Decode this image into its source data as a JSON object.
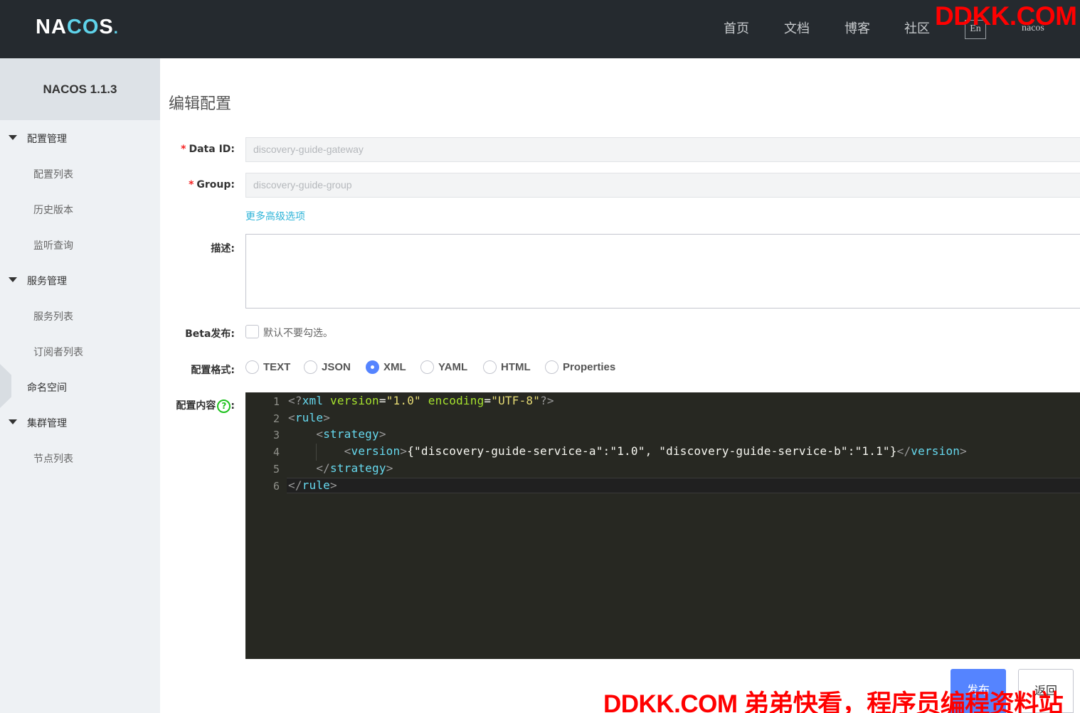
{
  "header": {
    "logo": {
      "prefix": "NA",
      "o1": "C",
      "o2": "O",
      "suffix": "S",
      "dot": "."
    },
    "nav": [
      "首页",
      "文档",
      "博客",
      "社区"
    ],
    "lang_button": "En",
    "user": "nacos",
    "watermark": "DDKK.COM"
  },
  "sidebar": {
    "title": "NACOS 1.1.3",
    "groups": [
      {
        "label": "配置管理",
        "items": [
          "配置列表",
          "历史版本",
          "监听查询"
        ]
      },
      {
        "label": "服务管理",
        "items": [
          "服务列表",
          "订阅者列表"
        ]
      },
      {
        "label": "命名空间",
        "items": []
      },
      {
        "label": "集群管理",
        "items": [
          "节点列表"
        ]
      }
    ]
  },
  "form": {
    "title": "编辑配置",
    "data_id": {
      "label": "Data ID:",
      "required": "*",
      "value": "discovery-guide-gateway"
    },
    "group": {
      "label": "Group:",
      "required": "*",
      "value": "discovery-guide-group"
    },
    "advanced_link": "更多高级选项",
    "description": {
      "label": "描述:",
      "value": ""
    },
    "beta": {
      "label": "Beta发布:",
      "checkbox_text": "默认不要勾选。",
      "checked": false
    },
    "format": {
      "label": "配置格式:",
      "options": [
        "TEXT",
        "JSON",
        "XML",
        "YAML",
        "HTML",
        "Properties"
      ],
      "selected": "XML"
    },
    "content": {
      "label": "配置内容",
      "help_icon": "?",
      "colon": ":",
      "line_numbers": [
        "1",
        "2",
        "3",
        "4",
        "5",
        "6"
      ],
      "lines": [
        "<?xml version=\"1.0\" encoding=\"UTF-8\"?>",
        "<rule>",
        "    <strategy>",
        "        <version>{\"discovery-guide-service-a\":\"1.0\", \"discovery-guide-service-b\":\"1.1\"}</version>",
        "    </strategy>",
        "</rule>"
      ]
    },
    "buttons": {
      "publish": "发布",
      "back": "返回"
    }
  },
  "watermark_bottom": "DDKK.COM 弟弟快看，程序员编程资料站",
  "colors": {
    "header_bg": "#252a2f",
    "sidebar_bg": "#eef1f4",
    "primary": "#5584ff",
    "link": "#2fb4d8",
    "editor_bg": "#272822",
    "watermark": "#ff0000"
  }
}
